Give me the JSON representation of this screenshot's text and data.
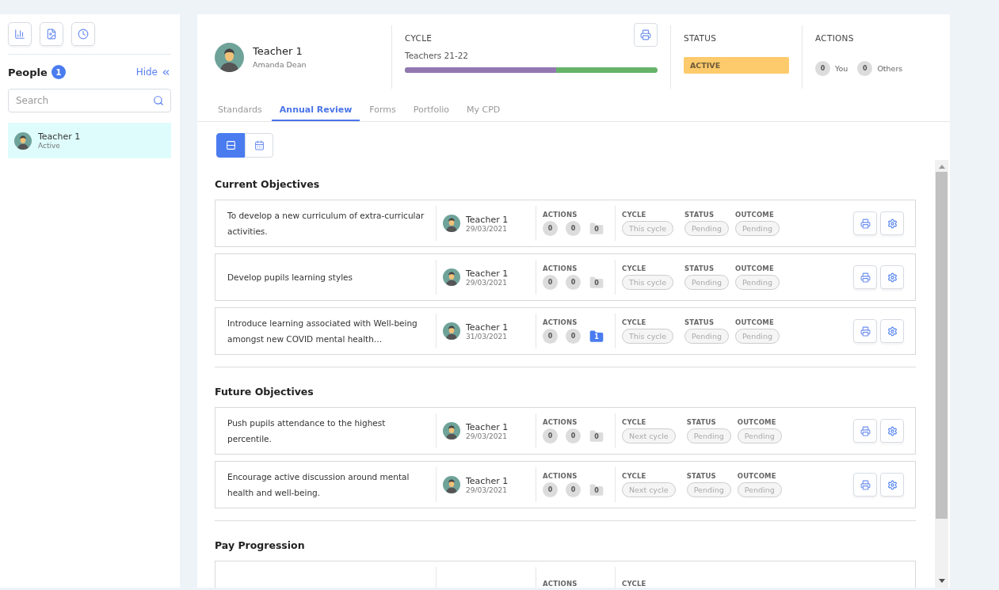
{
  "sidebar": {
    "tool_buttons": [
      {
        "kind": "chart"
      },
      {
        "kind": "report"
      },
      {
        "kind": "clock"
      }
    ],
    "people": {
      "title": "People",
      "count": "1",
      "hide_label": "Hide",
      "search_placeholder": "Search",
      "items": [
        {
          "name": "Teacher 1",
          "status": "Active",
          "selected": true
        }
      ]
    }
  },
  "header": {
    "name": "Teacher 1",
    "subname": "Amanda Dean",
    "cycle": {
      "label": "CYCLE",
      "name": "Teachers 21-22",
      "level": 0.6
    },
    "status": {
      "label": "STATUS",
      "value": "ACTIVE"
    },
    "actions": {
      "label": "ACTIONS",
      "items": [
        {
          "count": "0",
          "label": "You"
        },
        {
          "count": "0",
          "label": "Others"
        }
      ]
    }
  },
  "tabs": [
    {
      "label": "Standards",
      "selected": false
    },
    {
      "label": "Annual Review",
      "selected": true
    },
    {
      "label": "Forms",
      "selected": false
    },
    {
      "label": "Portfolio",
      "selected": false
    },
    {
      "label": "My CPD",
      "selected": false
    }
  ],
  "view_toggle": [
    {
      "kind": "list",
      "selected": true
    },
    {
      "kind": "calendar",
      "selected": false
    }
  ],
  "sections": [
    {
      "title": "Current Objectives",
      "rows": [
        {
          "text": "To develop a new curriculum of extra-curricular activities.",
          "teacher": "Teacher 1",
          "date": "29/03/2021",
          "labels": {
            "actions": "ACTIONS",
            "cycle": "CYCLE",
            "status": "STATUS",
            "outcome": "OUTCOME"
          },
          "counts": [
            "0",
            "0"
          ],
          "files": "0",
          "files_highlighted": false,
          "cycle": "This cycle",
          "status": "Pending",
          "outcome": "Pending"
        },
        {
          "text": "Develop pupils learning styles",
          "teacher": "Teacher 1",
          "date": "29/03/2021",
          "labels": {
            "actions": "ACTIONS",
            "cycle": "CYCLE",
            "status": "STATUS",
            "outcome": "OUTCOME"
          },
          "counts": [
            "0",
            "0"
          ],
          "files": "0",
          "files_highlighted": false,
          "cycle": "This cycle",
          "status": "Pending",
          "outcome": "Pending"
        },
        {
          "text": "Introduce learning associated with Well-being amongst new COVID mental health…",
          "teacher": "Teacher 1",
          "date": "31/03/2021",
          "labels": {
            "actions": "ACTIONS",
            "cycle": "CYCLE",
            "status": "STATUS",
            "outcome": "OUTCOME"
          },
          "counts": [
            "0",
            "0"
          ],
          "files": "1",
          "files_highlighted": true,
          "cycle": "This cycle",
          "status": "Pending",
          "outcome": "Pending"
        }
      ]
    },
    {
      "title": "Future Objectives",
      "rows": [
        {
          "text": "Push pupils attendance to the highest percentile.",
          "teacher": "Teacher 1",
          "date": "29/03/2021",
          "labels": {
            "actions": "ACTIONS",
            "cycle": "CYCLE",
            "status": "STATUS",
            "outcome": "OUTCOME"
          },
          "counts": [
            "0",
            "0"
          ],
          "files": "0",
          "files_highlighted": false,
          "cycle": "Next cycle",
          "status": "Pending",
          "outcome": "Pending"
        },
        {
          "text": "Encourage active discussion around mental health and well-being.",
          "teacher": "Teacher 1",
          "date": "29/03/2021",
          "labels": {
            "actions": "ACTIONS",
            "cycle": "CYCLE",
            "status": "STATUS",
            "outcome": "OUTCOME"
          },
          "counts": [
            "0",
            "0"
          ],
          "files": "0",
          "files_highlighted": false,
          "cycle": "Next cycle",
          "status": "Pending",
          "outcome": "Pending"
        }
      ]
    },
    {
      "title": "Pay Progression",
      "rows": [
        {
          "labels": {
            "actions": "ACTIONS",
            "cycle": "CYCLE"
          }
        }
      ]
    }
  ]
}
